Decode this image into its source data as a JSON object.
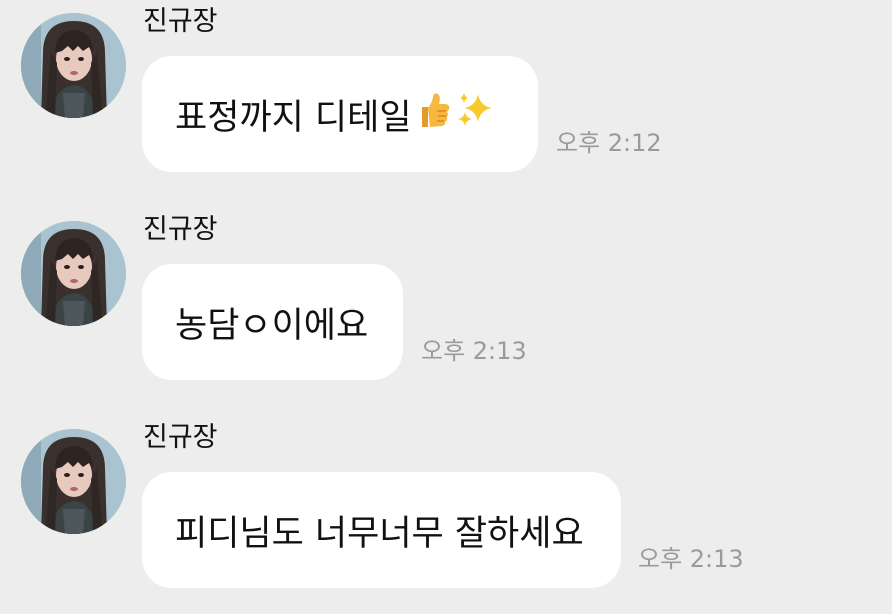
{
  "messages": [
    {
      "sender": "진규장",
      "text": "표정까지 디테일",
      "emojis": [
        "thumbs-up-icon",
        "sparkles-icon"
      ],
      "time": "오후 2:12"
    },
    {
      "sender": "진규장",
      "text": "농담ㅇ이에요",
      "emojis": [],
      "time": "오후 2:13"
    },
    {
      "sender": "진규장",
      "text": "피디님도 너무너무 잘하세요",
      "emojis": [],
      "time": "오후 2:13"
    }
  ],
  "colors": {
    "background": "#ededed",
    "bubble": "#ffffff",
    "time": "#9a9a9a"
  }
}
